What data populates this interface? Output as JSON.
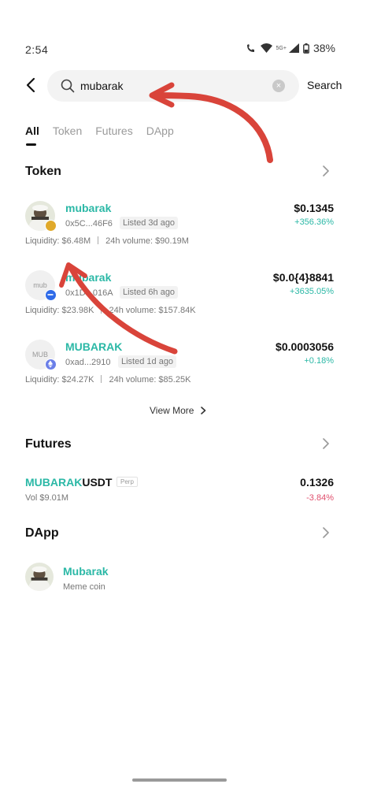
{
  "status_bar": {
    "time": "2:54",
    "network": "5G+",
    "battery": "38%"
  },
  "search": {
    "query": "mubarak",
    "button_label": "Search"
  },
  "tabs": [
    {
      "label": "All",
      "active": true
    },
    {
      "label": "Token",
      "active": false
    },
    {
      "label": "Futures",
      "active": false
    },
    {
      "label": "DApp",
      "active": false
    }
  ],
  "token_section": {
    "title": "Token",
    "items": [
      {
        "name": "mubarak",
        "address": "0x5C...46F6",
        "listed": "Listed 3d ago",
        "liquidity": "Liquidity: $6.48M",
        "volume": "24h volume: $90.19M",
        "price": "$0.1345",
        "change": "+356.36%",
        "avatar_label": "",
        "chain_color": "#e0a92a"
      },
      {
        "name": "mubarak",
        "address": "0x1D...016A",
        "listed": "Listed 6h ago",
        "liquidity": "Liquidity: $23.98K",
        "volume": "24h volume: $157.84K",
        "price": "$0.0{4}8841",
        "change": "+3635.05%",
        "avatar_label": "mub",
        "chain_color": "#2f6be8"
      },
      {
        "name": "MUBARAK",
        "address": "0xad...2910",
        "listed": "Listed 1d ago",
        "liquidity": "Liquidity: $24.27K",
        "volume": "24h volume: $85.25K",
        "price": "$0.0003056",
        "change": "+0.18%",
        "avatar_label": "MUB",
        "chain_color": "#6b7fe8"
      }
    ],
    "view_more": "View More"
  },
  "futures_section": {
    "title": "Futures",
    "pair_highlight": "MUBARAK",
    "pair_rest": "USDT",
    "tag": "Perp",
    "volume": "Vol $9.01M",
    "price": "0.1326",
    "change": "-3.84%"
  },
  "dapp_section": {
    "title": "DApp",
    "name": "Mubarak",
    "description": "Meme coin"
  },
  "colors": {
    "accent": "#2bb8a6",
    "negative": "#e0506e",
    "annotation": "#d9443a"
  }
}
